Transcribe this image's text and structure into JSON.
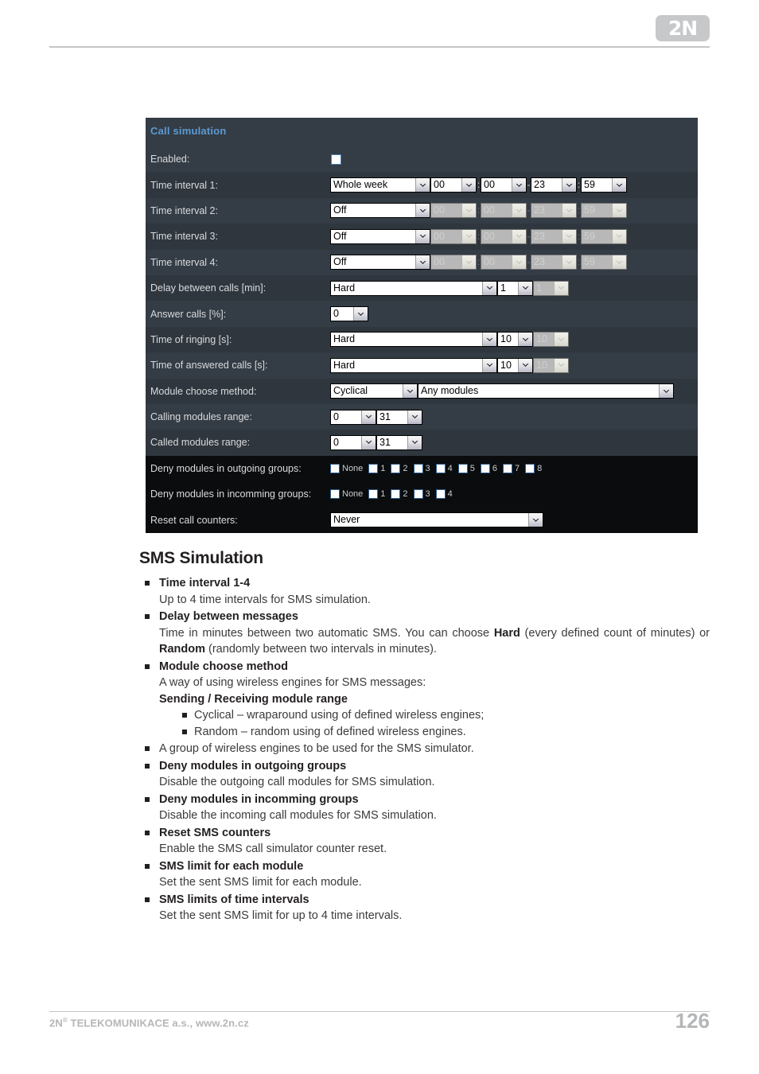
{
  "header": {
    "logo_text": "2N"
  },
  "panel": {
    "title": "Call simulation",
    "labels": {
      "enabled": "Enabled:",
      "time_interval_1": "Time interval 1:",
      "time_interval_2": "Time interval 2:",
      "time_interval_3": "Time interval 3:",
      "time_interval_4": "Time interval 4:",
      "delay_between_calls": "Delay between calls [min]:",
      "answer_calls": "Answer calls [%]:",
      "time_of_ringing": "Time of ringing [s]:",
      "time_of_answered_calls": "Time of answered calls [s]:",
      "module_choose_method": "Module choose method:",
      "calling_modules_range": "Calling modules range:",
      "called_modules_range": "Called modules range:",
      "deny_outgoing": "Deny modules in outgoing groups:",
      "deny_incoming": "Deny modules in incomming groups:",
      "reset_call_counters": "Reset call counters:"
    },
    "intervals": [
      {
        "day": "Whole week",
        "from_h": "00",
        "from_m": "00",
        "to_h": "23",
        "to_m": "59",
        "disabled": false
      },
      {
        "day": "Off",
        "from_h": "00",
        "from_m": "00",
        "to_h": "23",
        "to_m": "59",
        "disabled": true
      },
      {
        "day": "Off",
        "from_h": "00",
        "from_m": "00",
        "to_h": "23",
        "to_m": "59",
        "disabled": true
      },
      {
        "day": "Off",
        "from_h": "00",
        "from_m": "00",
        "to_h": "23",
        "to_m": "59",
        "disabled": true
      }
    ],
    "delay": {
      "mode": "Hard",
      "value": "1",
      "value2": "1"
    },
    "answer_calls": {
      "value": "0"
    },
    "ringing": {
      "mode": "Hard",
      "value": "10",
      "value2": "10"
    },
    "answered": {
      "mode": "Hard",
      "value": "10",
      "value2": "10"
    },
    "module_method": {
      "method": "Cyclical",
      "modules": "Any modules"
    },
    "calling_range": {
      "from": "0",
      "to": "31"
    },
    "called_range": {
      "from": "0",
      "to": "31"
    },
    "deny_outgoing_options": [
      "None",
      "1",
      "2",
      "3",
      "4",
      "5",
      "6",
      "7",
      "8"
    ],
    "deny_incoming_options": [
      "None",
      "1",
      "2",
      "3",
      "4"
    ],
    "reset_call_counters": "Never",
    "separators": {
      "colon": ":",
      "dash": "-"
    },
    "accent_color": "#5b9bd5",
    "background_color": "#343c45"
  },
  "content": {
    "section_title": "SMS Simulation",
    "items": [
      {
        "term": "Time interval 1-4",
        "desc": "Up to 4 time intervals for SMS simulation."
      },
      {
        "term": "Delay between messages",
        "desc_pre": "Time in minutes between two automatic SMS. You can choose ",
        "desc_bold1": "Hard",
        "desc_mid": " (every defined count of minutes) or ",
        "desc_bold2": "Random",
        "desc_post": " (randomly between two intervals in minutes)."
      },
      {
        "term": "Module choose method",
        "desc": "A way of using wireless engines for SMS messages:",
        "subheading": "Sending / Receiving module range",
        "sub_items": [
          "Cyclical – wraparound using of defined wireless engines;",
          "Random – random using of defined wireless engines."
        ]
      },
      {
        "term": "",
        "desc": "A group of wireless engines to be used for the SMS simulator."
      },
      {
        "term": "Deny modules in outgoing groups",
        "desc": "Disable the outgoing call modules for SMS simulation."
      },
      {
        "term": "Deny modules in incomming groups",
        "desc": "Disable the incoming call modules for SMS simulation."
      },
      {
        "term": "Reset SMS counters",
        "desc": "Enable the SMS call simulator counter reset."
      },
      {
        "term": "SMS limit for each module",
        "desc": "Set the sent SMS limit for each module."
      },
      {
        "term": "SMS limits of time intervals",
        "desc": "Set the sent SMS limit for up to 4 time intervals."
      }
    ]
  },
  "footer": {
    "company": "TELEKOMUNIKACE a.s., www.2n.cz",
    "company_prefix": "2N",
    "registered_mark": "®",
    "page_number": "126"
  }
}
